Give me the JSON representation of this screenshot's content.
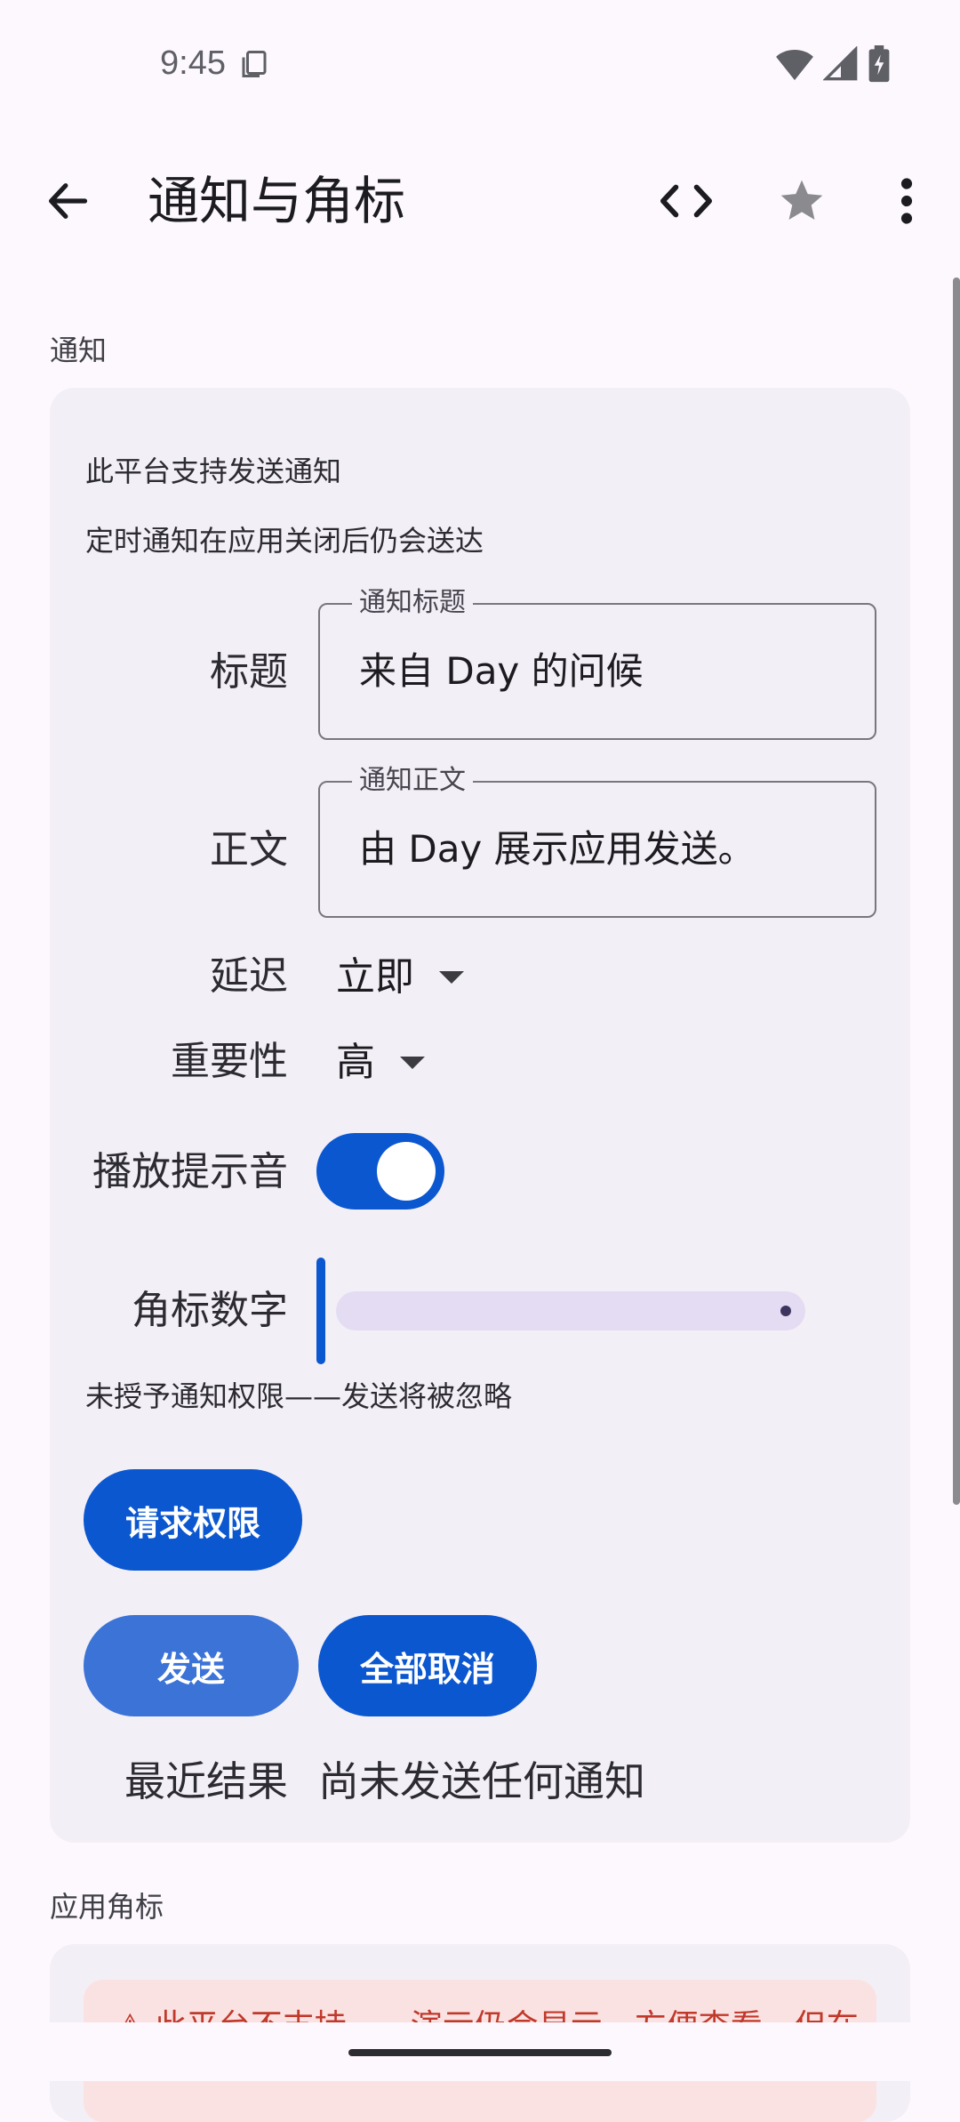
{
  "status_bar": {
    "time": "9:45",
    "icons": [
      "copy-icon",
      "wifi-icon",
      "signal-icon",
      "battery-charging-icon"
    ]
  },
  "app_bar": {
    "title": "通知与角标",
    "back_icon": "arrow-back-icon",
    "code_icon": "code-icon",
    "star_icon": "star-icon",
    "more_icon": "more-vert-icon"
  },
  "notify_section": {
    "header": "通知",
    "support_text": "此平台支持发送通知",
    "scheduled_text": "定时通知在应用关闭后仍会送达",
    "title_row": {
      "label": "标题",
      "field_label": "通知标题",
      "value": "来自 Day 的问候"
    },
    "body_row": {
      "label": "正文",
      "field_label": "通知正文",
      "value": "由 Day 展示应用发送。"
    },
    "delay_row": {
      "label": "延迟",
      "value": "立即"
    },
    "importance_row": {
      "label": "重要性",
      "value": "高"
    },
    "sound_row": {
      "label": "播放提示音",
      "enabled": true
    },
    "badge_row": {
      "label": "角标数字",
      "value_fraction": 0
    },
    "permission_text": "未授予通知权限——发送将被忽略",
    "request_button": "请求权限",
    "send_button": "发送",
    "cancel_all_button": "全部取消",
    "result_label": "最近结果",
    "result_value": "尚未发送任何通知"
  },
  "badge_section": {
    "header": "应用角标",
    "warning_text": "⚠ 此平台不支持……演示仍会显示，方便查看，但在"
  },
  "colors": {
    "background": "#fdf8fe",
    "card": "#f3eff6",
    "primary": "#0b57d0",
    "primary_light": "#3b73d7",
    "warning_bg": "#fbe2e2",
    "warning_text": "#c0392b"
  }
}
